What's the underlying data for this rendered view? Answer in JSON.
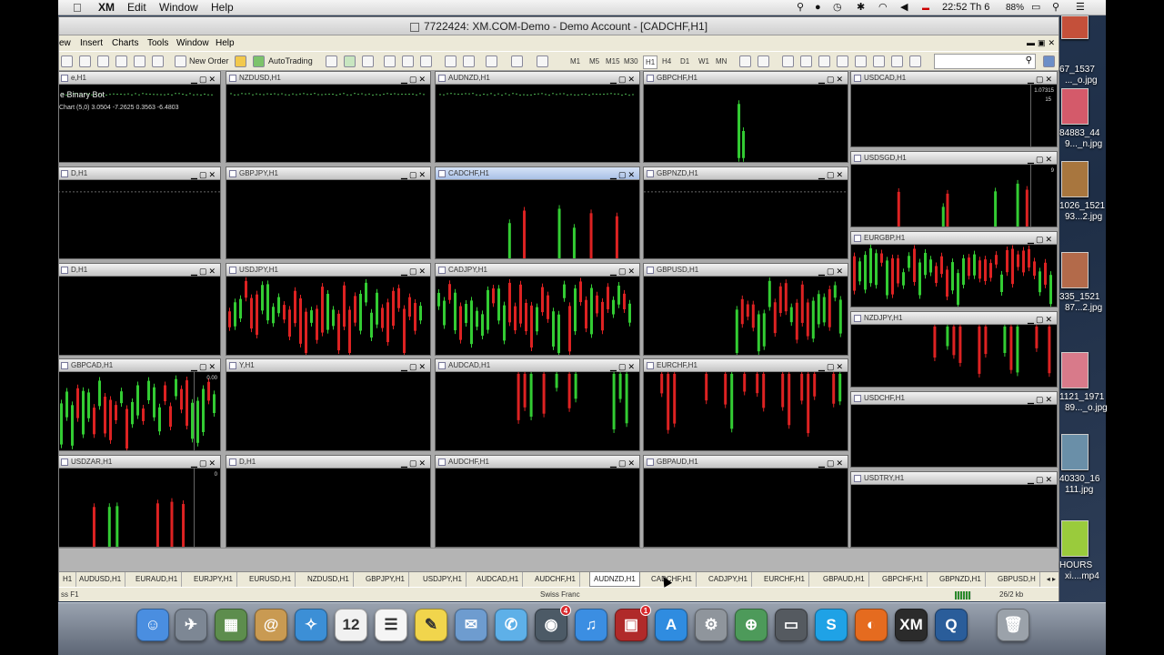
{
  "menubar": {
    "app": "XM",
    "items": [
      "Edit",
      "Window",
      "Help"
    ],
    "clock": "22:52 Th 6",
    "battery": "88%"
  },
  "window": {
    "title": "7722424: XM.COM-Demo - Demo Account - [CADCHF,H1]",
    "menu": [
      "ew",
      "Insert",
      "Charts",
      "Tools",
      "Window",
      "Help"
    ],
    "toolbar": {
      "new_order": "New Order",
      "autotrading": "AutoTrading",
      "timeframes": [
        "M1",
        "M5",
        "M15",
        "M30",
        "H1",
        "H4",
        "D1",
        "W1",
        "MN"
      ]
    }
  },
  "charts": [
    {
      "title": "e,H1",
      "bot": "e Binary Bot",
      "sub": "Chart (5,0) 3.0504 -7.2625 0.3563 -6.4803",
      "kind": "dots"
    },
    {
      "title": "NZDUSD,H1",
      "kind": "dots"
    },
    {
      "title": "AUDNZD,H1",
      "kind": "dots"
    },
    {
      "title": "GBPCHF,H1",
      "kind": "spike"
    },
    {
      "title": "USDCAD,H1",
      "price": "1.07315",
      "price2": "15",
      "kind": "empty"
    },
    {
      "title": "D,H1",
      "kind": "dash"
    },
    {
      "title": "GBPJPY,H1",
      "kind": "empty"
    },
    {
      "title": "CADCHF,H1",
      "kind": "sparse",
      "active": true
    },
    {
      "title": "GBPNZD,H1",
      "kind": "dash"
    },
    {
      "title": "USDSGD,H1",
      "price": "9",
      "kind": "sparse"
    },
    {
      "title": "D,H1",
      "kind": "empty"
    },
    {
      "title": "USDJPY,H1",
      "kind": "dense"
    },
    {
      "title": "CADJPY,H1",
      "kind": "dense"
    },
    {
      "title": "GBPUSD,H1",
      "kind": "dense"
    },
    {
      "title": "EURGBP,H1",
      "kind": "dense"
    },
    {
      "title": "GBPCAD,H1",
      "price": "0.00",
      "kind": "dense"
    },
    {
      "title": "Y,H1",
      "kind": "empty"
    },
    {
      "title": "AUDCAD,H1",
      "kind": "redhang"
    },
    {
      "title": "EURCHF,H1",
      "kind": "redhang"
    },
    {
      "title": "NZDJPY,H1",
      "kind": "redhang"
    },
    {
      "title": "USDZAR,H1",
      "price": "0",
      "kind": "sparse"
    },
    {
      "title": "D,H1",
      "kind": "empty"
    },
    {
      "title": "AUDCHF,H1",
      "kind": "empty"
    },
    {
      "title": "GBPAUD,H1",
      "kind": "empty"
    },
    {
      "title": "USDCHF,H1",
      "kind": "empty"
    },
    {
      "title": "USDTRY,H1",
      "kind": "empty"
    }
  ],
  "tabs": [
    "H1",
    "AUDUSD,H1",
    "EURAUD,H1",
    "EURJPY,H1",
    "EURUSD,H1",
    "NZDUSD,H1",
    "GBPJPY,H1",
    "USDJPY,H1",
    "AUDCAD,H1",
    "AUDCHF,H1",
    "AUDNZD,H1",
    "CADCHF,H1",
    "CADJPY,H1",
    "EURCHF,H1",
    "GBPAUD,H1",
    "GBPCHF,H1",
    "GBPNZD,H1",
    "GBPUSD,H"
  ],
  "status": {
    "left": "ss F1",
    "center": "Swiss Franc",
    "right": "26/2 kb"
  },
  "desktop": [
    {
      "label": "67_1537",
      "label2": "..._o.jpg"
    },
    {
      "label": "84883_44",
      "label2": "9..._n.jpg"
    },
    {
      "label": "1026_1521",
      "label2": "93...2.jpg"
    },
    {
      "label": "335_1521",
      "label2": "87...2.jpg"
    },
    {
      "label": "1121_1971",
      "label2": "89..._o.jpg"
    },
    {
      "label": "40330_16",
      "label2": "111.jpg"
    },
    {
      "label": "HOURS",
      "label2": "xi....mp4"
    }
  ],
  "dock": [
    {
      "name": "finder-icon",
      "g": "☺",
      "c": "#4a8ee0"
    },
    {
      "name": "launchpad-icon",
      "g": "✈",
      "c": "#7d8794"
    },
    {
      "name": "migration-icon",
      "g": "▦",
      "c": "#5d8d4d"
    },
    {
      "name": "contacts-icon",
      "g": "@",
      "c": "#c99a52"
    },
    {
      "name": "safari-icon",
      "g": "✧",
      "c": "#3c8fd6"
    },
    {
      "name": "calendar-icon",
      "g": "12",
      "c": "#f1f1f1"
    },
    {
      "name": "reminders-icon",
      "g": "☰",
      "c": "#f5f5f5"
    },
    {
      "name": "notes-icon",
      "g": "✎",
      "c": "#f1d54c"
    },
    {
      "name": "mail-icon",
      "g": "✉",
      "c": "#6e9ccf"
    },
    {
      "name": "messages-icon",
      "g": "✆",
      "c": "#5eb0e8"
    },
    {
      "name": "facetime-icon",
      "g": "◉",
      "c": "#4c5a66",
      "badge": "4"
    },
    {
      "name": "itunes-icon",
      "g": "♫",
      "c": "#3b8ee2"
    },
    {
      "name": "photobooth-icon",
      "g": "▣",
      "c": "#b02a2a",
      "badge": "1"
    },
    {
      "name": "appstore-icon",
      "g": "A",
      "c": "#2f8ce0"
    },
    {
      "name": "system-preferences-icon",
      "g": "⚙",
      "c": "#8f959c"
    },
    {
      "name": "network-icon",
      "g": "⊕",
      "c": "#4d9a5a"
    },
    {
      "name": "tv-icon",
      "g": "▭",
      "c": "#555a60"
    },
    {
      "name": "skype-icon",
      "g": "S",
      "c": "#1fa2e6"
    },
    {
      "name": "firefox-icon",
      "g": "◐",
      "c": "#e56b1f"
    },
    {
      "name": "xm-icon",
      "g": "XM",
      "c": "#2b2b2b"
    },
    {
      "name": "quicktime-icon",
      "g": "Q",
      "c": "#2a5d9a"
    },
    {
      "name": "trash-icon",
      "g": "🗑",
      "c": "#9ba2aa"
    }
  ]
}
